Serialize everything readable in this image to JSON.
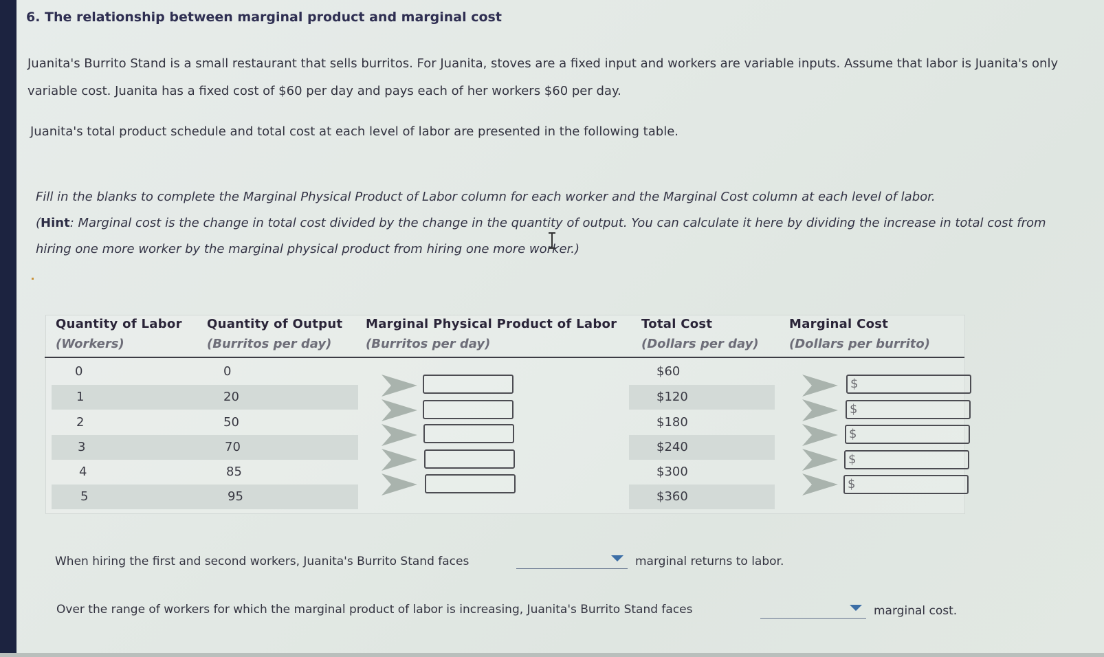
{
  "question": {
    "title": "6. The relationship between marginal product and marginal cost",
    "intro": "Juanita's Burrito Stand is a small restaurant that sells burritos. For Juanita, stoves are a fixed input and workers are variable inputs. Assume that labor is Juanita's only variable cost. Juanita has a fixed cost of $60 per day and pays each of her workers $60 per day.",
    "table_intro": "Juanita's total product schedule and total cost at each level of labor are presented in the following table.",
    "instructions": "Fill in the blanks to complete the Marginal Physical Product of Labor column for each worker and the Marginal Cost column at each level of labor.",
    "hint_label": "Hint",
    "hint_text": ": Marginal cost is the change in total cost divided by the change in the quantity of output. You can calculate it here by dividing the increase in total cost from hiring one more worker by the marginal physical product from hiring one more worker.)",
    "hint_open": "("
  },
  "table": {
    "columns": [
      {
        "title": "Quantity of Labor",
        "unit": "(Workers)"
      },
      {
        "title": "Quantity of Output",
        "unit": "(Burritos per day)"
      },
      {
        "title": "Marginal Physical Product of Labor",
        "unit": "(Burritos per day)"
      },
      {
        "title": "Total Cost",
        "unit": "(Dollars per day)"
      },
      {
        "title": "Marginal Cost",
        "unit": "(Dollars per burrito)"
      }
    ],
    "rows": [
      {
        "labor": "0",
        "output": "0",
        "total_cost": "$60"
      },
      {
        "labor": "1",
        "output": "20",
        "total_cost": "$120"
      },
      {
        "labor": "2",
        "output": "50",
        "total_cost": "$180"
      },
      {
        "labor": "3",
        "output": "70",
        "total_cost": "$240"
      },
      {
        "labor": "4",
        "output": "85",
        "total_cost": "$300"
      },
      {
        "labor": "5",
        "output": "95",
        "total_cost": "$360"
      }
    ],
    "mpl_inputs": [
      "",
      "",
      "",
      "",
      ""
    ],
    "mc_inputs": [
      {
        "prefix": "$",
        "value": ""
      },
      {
        "prefix": "$",
        "value": ""
      },
      {
        "prefix": "$",
        "value": ""
      },
      {
        "prefix": "$",
        "value": ""
      },
      {
        "prefix": "$",
        "value": ""
      }
    ]
  },
  "questions": [
    {
      "before": "When hiring the first and second workers, Juanita's Burrito Stand faces",
      "selected": "",
      "after": "marginal returns to labor."
    },
    {
      "before": "Over the range of workers for which the marginal product of labor is increasing, Juanita's Burrito Stand faces",
      "selected": "",
      "after": "marginal cost."
    }
  ],
  "colors": {
    "dropdown_caret": "#3c6ea6",
    "stripe": "#d3dad7"
  }
}
